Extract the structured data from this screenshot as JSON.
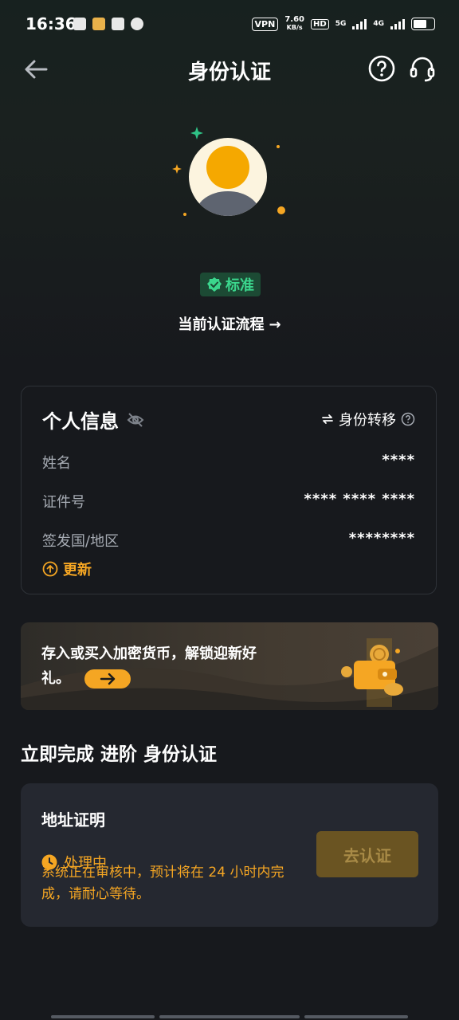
{
  "status_bar": {
    "time": "16:36",
    "vpn": "VPN",
    "speed_value": "7.60",
    "speed_unit": "KB/s",
    "hd": "HD",
    "net1": "5G",
    "net2": "4G"
  },
  "header": {
    "title": "身份认证"
  },
  "verification": {
    "badge_label": "标准",
    "flow_link": "当前认证流程"
  },
  "personal_info": {
    "title": "个人信息",
    "transfer_label": "身份转移",
    "rows": [
      {
        "label": "姓名",
        "value": "****"
      },
      {
        "label": "证件号",
        "value": "**** **** ****"
      },
      {
        "label": "签发国/地区",
        "value": "********"
      }
    ],
    "update_label": "更新"
  },
  "promo": {
    "text": "存入或买入加密货币，解锁迎新好礼。"
  },
  "advance": {
    "section_title": "立即完成 进阶 身份认证",
    "item_name": "地址证明",
    "status": "处理中",
    "description": "系统正在审核中，预计将在 24 小时内完成，请耐心等待。",
    "button_label": "去认证"
  },
  "colors": {
    "background": "#17191d",
    "accent": "#f5a623",
    "success": "#3bd68d",
    "card": "#252830"
  }
}
